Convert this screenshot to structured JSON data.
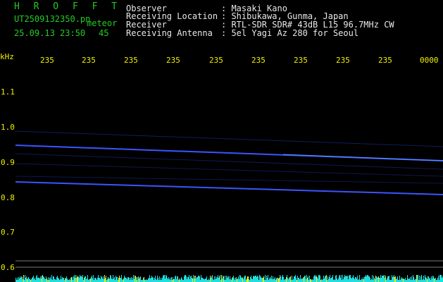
{
  "header": {
    "title": "H R O F F T",
    "file_name": "UT2509132350.pn",
    "meteor_label": "meteor",
    "datetime": "25.09.13 23:50",
    "count": "45"
  },
  "info": {
    "labels": [
      "Observer",
      "Receiving Location",
      "Receiver",
      "Receiving Antenna"
    ],
    "values": [
      ": Masaki Kano",
      ": Shibukawa, Gunma, Japan",
      ": RTL-SDR SDR# 43dB L15 96.7MHz CW",
      ": 5el Yagi Az 280 for Seoul"
    ]
  },
  "axis": {
    "unit": "kHz",
    "y_ticks": [
      "1.1",
      "1.0",
      "0.9",
      "0.8",
      "0.7",
      "0.6"
    ],
    "x_ticks": [
      "235",
      "235",
      "235",
      "235",
      "235",
      "235",
      "235",
      "235",
      "235",
      "0000"
    ]
  },
  "colors": {
    "header_text": "#22cc22",
    "axis_text": "#f0f000",
    "signal": "#3344ff",
    "baseline_noise": "#22dddd"
  }
}
